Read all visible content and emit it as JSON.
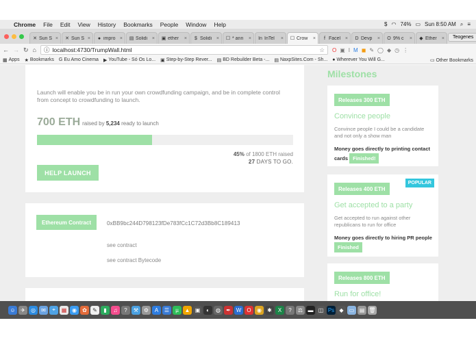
{
  "menubar": {
    "items": [
      "Chrome",
      "File",
      "Edit",
      "View",
      "History",
      "Bookmarks",
      "People",
      "Window",
      "Help"
    ],
    "battery": "74%",
    "clock": "Sun 8:50 AM"
  },
  "tabs": [
    {
      "icon": "✕",
      "label": "Sun S"
    },
    {
      "icon": "✕",
      "label": "Sun S"
    },
    {
      "icon": "●",
      "label": "impro"
    },
    {
      "icon": "▤",
      "label": "Solidi"
    },
    {
      "icon": "▣",
      "label": "ether"
    },
    {
      "icon": "$",
      "label": "Solidi"
    },
    {
      "icon": "☐",
      "label": "* ann"
    },
    {
      "icon": "In",
      "label": "InTel"
    },
    {
      "icon": "☐",
      "label": "Crow"
    },
    {
      "icon": "f",
      "label": "Facel"
    },
    {
      "icon": "D",
      "label": "Devp"
    },
    {
      "icon": "O",
      "label": "9% c"
    },
    {
      "icon": "◆",
      "label": "Ether"
    }
  ],
  "profile": "Teogenes",
  "address": {
    "url": "localhost:4730/TrumpWall.html"
  },
  "bookmarks": [
    {
      "icon": "▦",
      "label": "Apps"
    },
    {
      "icon": "★",
      "label": "Bookmarks"
    },
    {
      "icon": "G",
      "label": "Eu Amo Cinema"
    },
    {
      "icon": "▶",
      "label": "YouTube - Só Os Lo..."
    },
    {
      "icon": "▣",
      "label": "Step-by-Step Rever..."
    },
    {
      "icon": "▤",
      "label": "BD Rebuilder Beta -..."
    },
    {
      "icon": "▤",
      "label": "NaxpSites.Com - Sh..."
    },
    {
      "icon": "●",
      "label": "Wherever You Will G..."
    }
  ],
  "other_bookmarks": "Other Bookmarks",
  "intro": {
    "text": "Launch will enable you be in run your own crowdfunding campaign, and be in complete control from concept to crowdfunding to launch.",
    "amount": "700 ETH",
    "raised_by": "raised by",
    "backers": "5,234",
    "ready": "ready to launch",
    "progress_fraction": 0.45,
    "percent": "45%",
    "of_goal": "of 1800 ETH raised",
    "days": "27",
    "days_label": "DAYS TO GO.",
    "button": "HELP LAUNCH"
  },
  "contract": {
    "button": "Ethereum Contract",
    "address": "0xBB9bc244D798123fDe783fCc1C72d3Bb8C189413",
    "see_contract": "see contract",
    "see_bytecode": "see contract Bytecode"
  },
  "milestones": {
    "title": "Milestones",
    "items": [
      {
        "badge": "Releases 300 ETH",
        "title": "Convince people",
        "desc": "Convince people I could be a candidate and not only a show man",
        "money": "Money goes directly to printing contact cards",
        "status": "Finished!"
      },
      {
        "badge": "Releases 400 ETH",
        "popular": "POPULAR",
        "title": "Get accepted to a party",
        "desc": "Get accepted to run against other republicans to run for office",
        "money": "Money goes directly to hiring PR people",
        "status": "Finished"
      },
      {
        "badge": "Releases 800 ETH",
        "title": "Run for office!"
      }
    ]
  },
  "colors": {
    "accent": "#9ee0a6",
    "popular": "#33c6dd"
  }
}
